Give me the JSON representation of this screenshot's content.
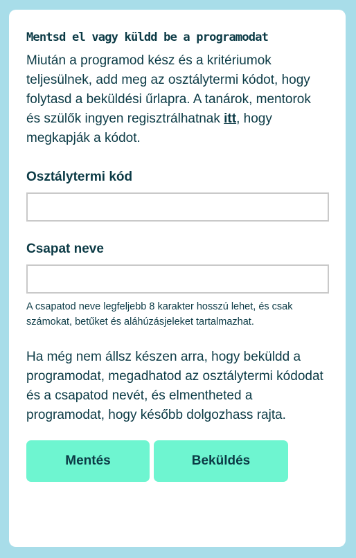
{
  "panel": {
    "title": "Mentsd el vagy küldd be a programodat",
    "intro_before_link": "Miután a programod kész és a kritériumok teljesülnek, add meg az osztálytermi kódot, hogy folytasd a beküldési űrlapra. A tanárok, mentorok és szülők ingyen regisztrálhatnak ",
    "intro_link": "itt",
    "intro_after_link": ", hogy megkapják a kódot."
  },
  "form": {
    "classroom_code": {
      "label": "Osztálytermi kód",
      "value": ""
    },
    "team_name": {
      "label": "Csapat neve",
      "value": "",
      "hint": "A csapatod neve legfeljebb 8 karakter hosszú lehet, és csak számokat, betűket és aláhúzásjeleket tartalmazhat."
    }
  },
  "outro": "Ha még nem állsz készen arra, hogy beküldd a programodat, megadhatod az osztálytermi kódodat és a csapatod nevét, és elmentheted a programodat, hogy később dolgozhass rajta.",
  "actions": {
    "save_label": "Mentés",
    "submit_label": "Beküldés"
  },
  "colors": {
    "background": "#a8dde9",
    "card": "#ffffff",
    "text": "#0b3a45",
    "button": "#6ef5d0",
    "input_border": "#c9c9c9"
  }
}
